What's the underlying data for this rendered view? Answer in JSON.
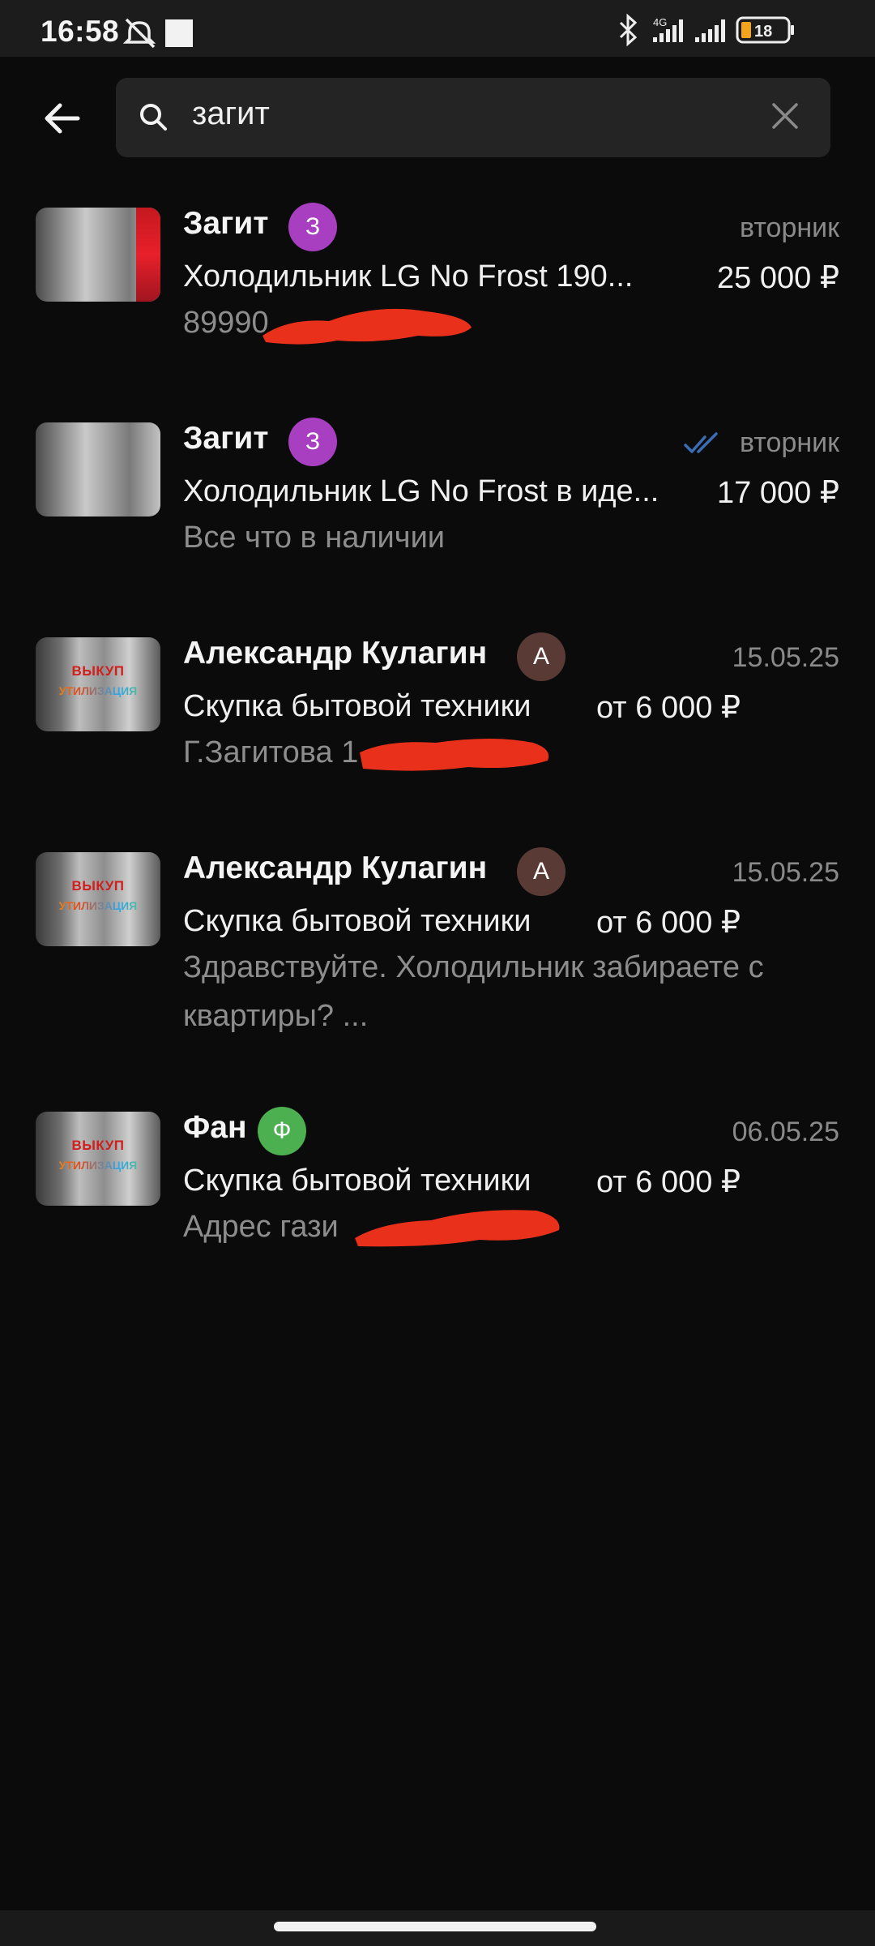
{
  "status_bar": {
    "time": "16:58",
    "network": "4G",
    "battery": "18",
    "icons": [
      "bell-off-icon",
      "square-notification-icon",
      "bluetooth-icon",
      "signal-icon",
      "battery-icon"
    ]
  },
  "search": {
    "query": "загит",
    "icons": {
      "back": "back-arrow-icon",
      "search": "search-icon",
      "clear": "close-icon"
    }
  },
  "chats": [
    {
      "name": "Загит",
      "avatar_letter": "З",
      "avatar_color": "#a83ec0",
      "date": "вторник",
      "read_checks": false,
      "title": "Холодильник LG No Frost 190...",
      "price": "25 000 ₽",
      "message": "89990",
      "thumbnail": "fridge-red"
    },
    {
      "name": "Загит",
      "avatar_letter": "З",
      "avatar_color": "#a83ec0",
      "date": "вторник",
      "read_checks": true,
      "title": "Холодильник LG No Frost в иде...",
      "price": "17 000 ₽",
      "message": "Все что в наличии",
      "thumbnail": "fridge"
    },
    {
      "name": "Александр Кулагин",
      "avatar_letter": "А",
      "avatar_color": "#5a3a34",
      "date": "15.05.25",
      "read_checks": false,
      "title": "Скупка бытовой техники",
      "price": "от 6 000 ₽",
      "message": "Г.Загитова 1",
      "thumbnail": "buyout"
    },
    {
      "name": "Александр Кулагин",
      "avatar_letter": "А",
      "avatar_color": "#5a3a34",
      "date": "15.05.25",
      "read_checks": false,
      "title": "Скупка бытовой техники",
      "price": "от 6 000 ₽",
      "message": "Здравствуйте. Холодильник забираете с",
      "message_line2": "квартиры? ...",
      "thumbnail": "buyout"
    },
    {
      "name": "Фан",
      "avatar_letter": "Ф",
      "avatar_color": "#4caf50",
      "date": "06.05.25",
      "read_checks": false,
      "title": "Скупка бытовой техники",
      "price": "от 6 000 ₽",
      "message": "Адрес гази",
      "thumbnail": "buyout"
    }
  ],
  "thumbnail_text": {
    "line1": "ВЫКУП",
    "line2": "УТИЛИЗАЦИЯ"
  },
  "colors": {
    "background": "#0b0b0b",
    "secondary_text": "#8a8a8a",
    "read_check": "#3b6db5",
    "redaction": "#e8301a"
  }
}
